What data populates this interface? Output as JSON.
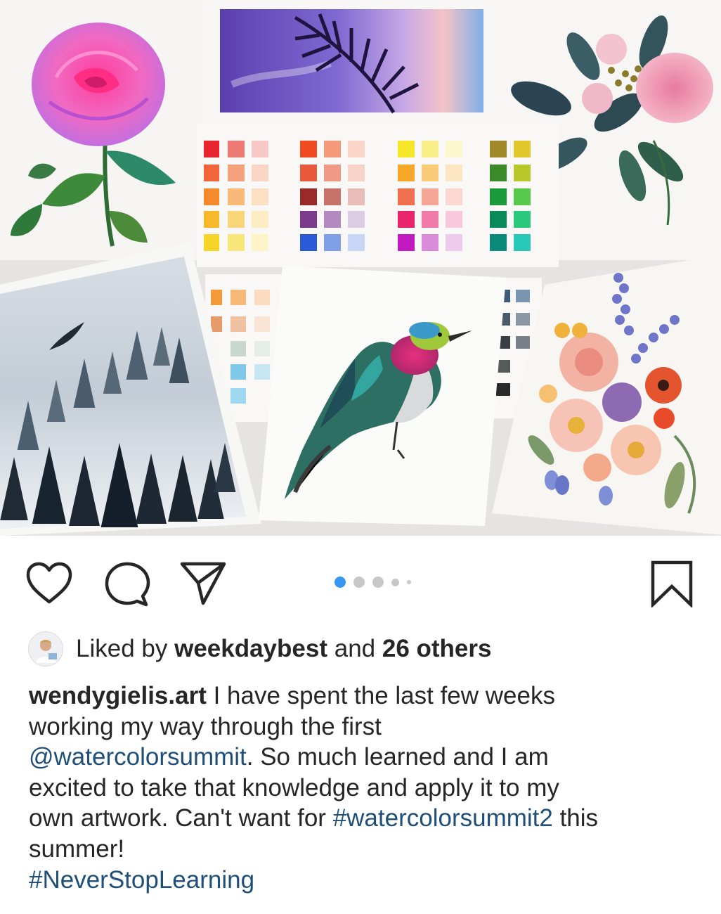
{
  "post": {
    "image_alt": "Collage of watercolor paintings: pink rose, palm leaf at sunset, pink peony bouquet, color swatch charts, misty pine forest with bird, hummingbird, floral bouquet",
    "carousel": {
      "total": 5,
      "active_index": 1
    }
  },
  "actions": {
    "like_icon": "heart-icon",
    "comment_icon": "comment-bubble-icon",
    "share_icon": "paper-plane-icon",
    "save_icon": "bookmark-icon"
  },
  "likes": {
    "prefix": "Liked by ",
    "user": "weekdaybest",
    "middle": " and ",
    "others": "26 others"
  },
  "caption": {
    "username": "wendygielis.art",
    "line1_text": " I have spent the last few weeks",
    "line2_text": "working my way through the first",
    "mention": "@watercolorsummit",
    "line3_text": ". So much learned and I am",
    "line4_text": "excited to take that knowledge and apply it to my",
    "line5_text": "own artwork. Can't want for ",
    "hashtag1": "#watercolorsummit2",
    "line5_end": " this",
    "line6_text": "summer!",
    "hashtag2": "#NeverStopLearning"
  },
  "colors": {
    "text": "#262626",
    "link": "#1f4e79",
    "dot_active": "#3897f0",
    "dot_inactive": "#c7c7c7"
  }
}
